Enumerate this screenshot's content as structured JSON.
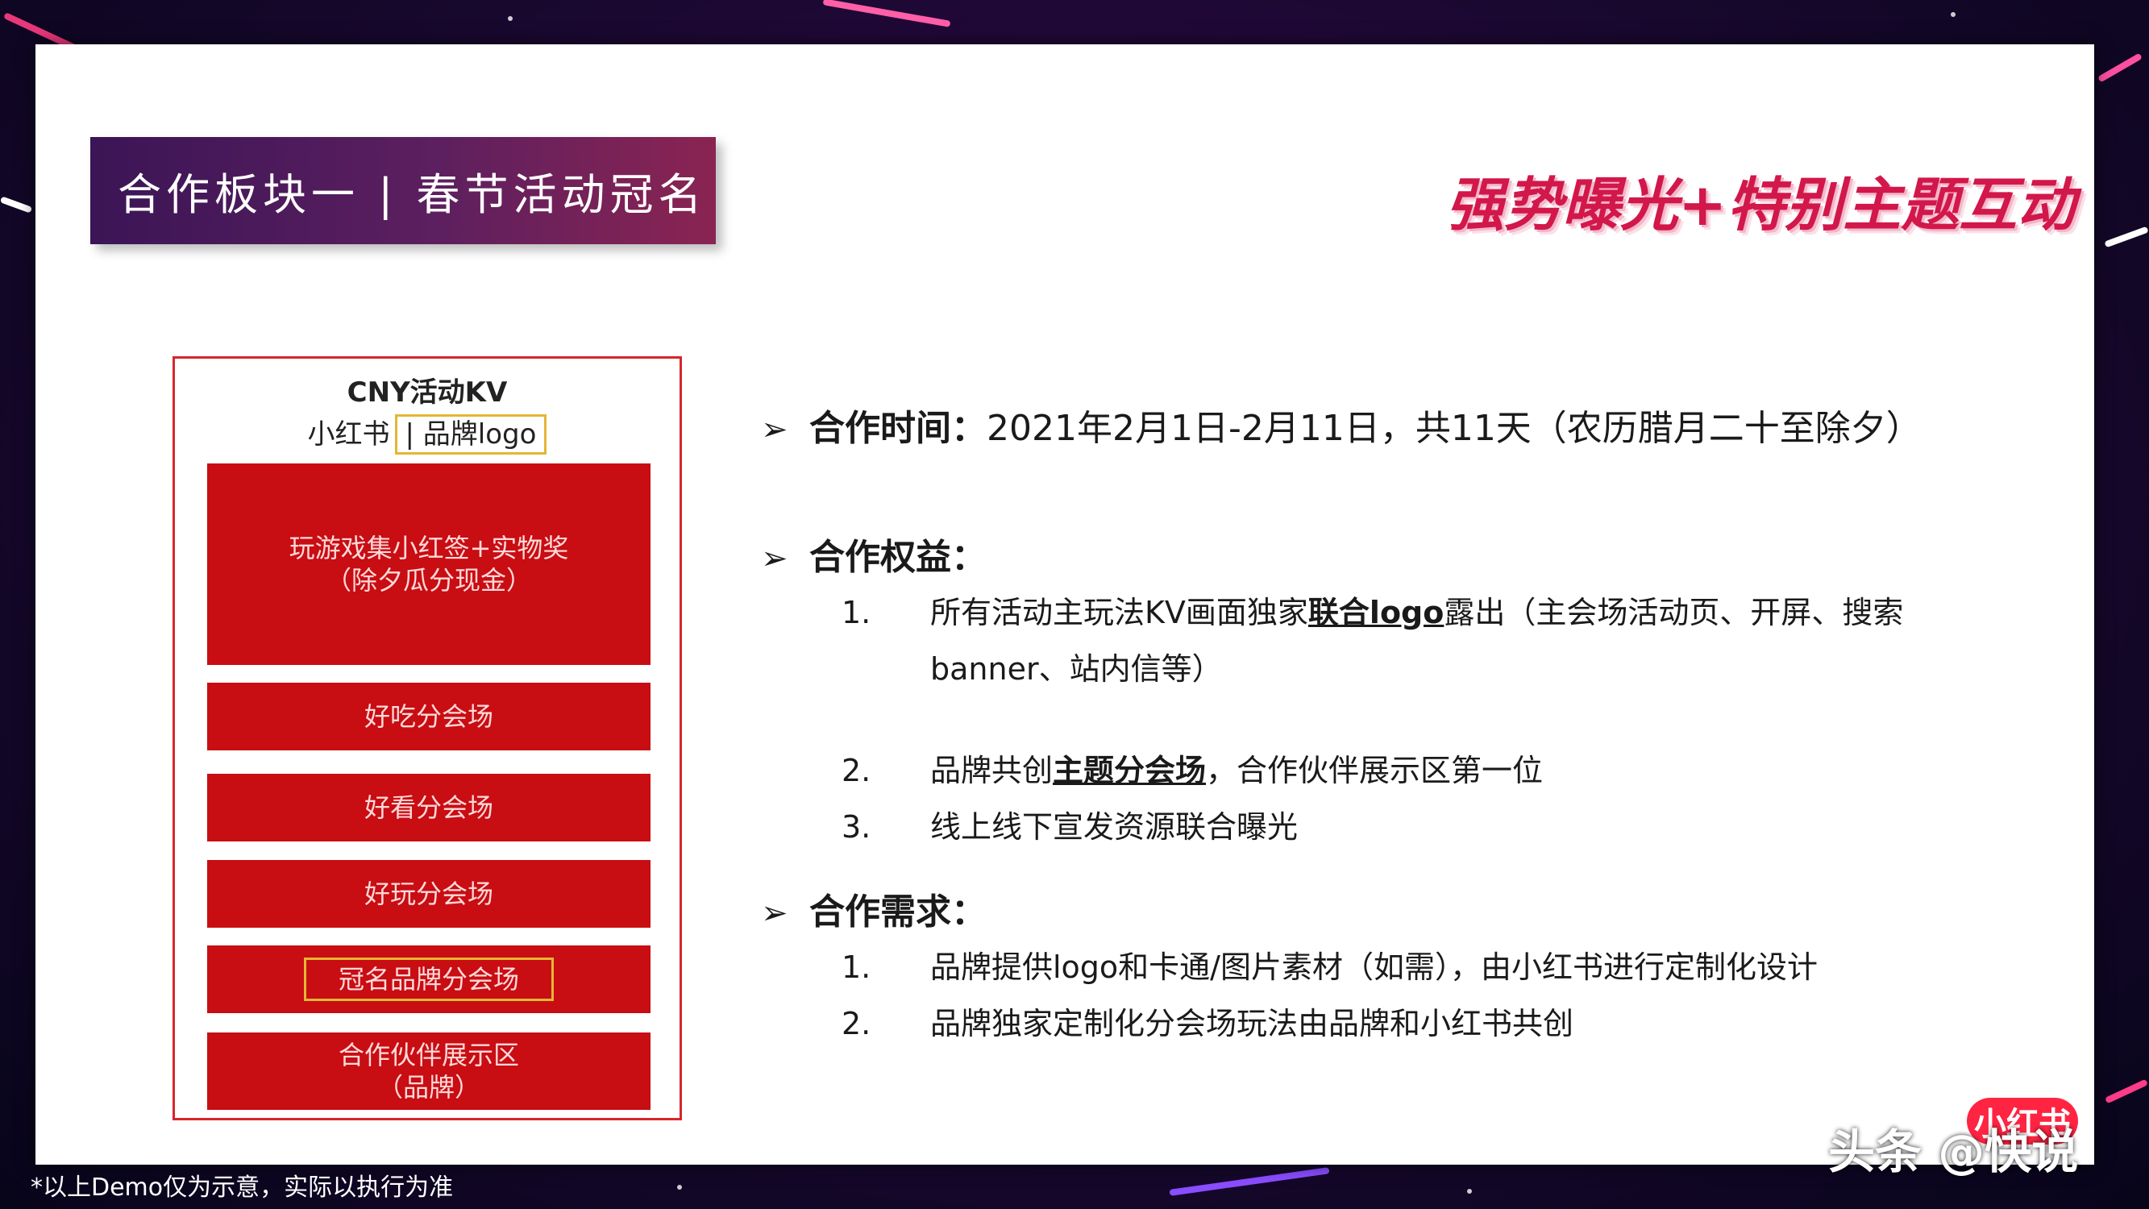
{
  "header": {
    "title": "合作板块一 | 春节活动冠名",
    "slogan": "强势曝光+特别主题互动"
  },
  "demo": {
    "kv_title": "CNY活动KV",
    "kv_brand_left": "小红书",
    "kv_brand_right": "| 品牌logo",
    "main_block_line1": "玩游戏集小红签+实物奖",
    "main_block_line2": "（除夕瓜分现金）",
    "venue_food": "好吃分会场",
    "venue_look": "好看分会场",
    "venue_play": "好玩分会场",
    "venue_brand": "冠名品牌分会场",
    "partner_line1": "合作伙伴展示区",
    "partner_line2": "（品牌）"
  },
  "content": {
    "arrow": "➢",
    "time_label": "合作时间：",
    "time_text": "2021年2月1日-2月11日，共11天（农历腊月二十至除夕）",
    "benefits_label": "合作权益：",
    "benefits": [
      {
        "num": "1.",
        "pre": "所有活动主玩法KV画面独家",
        "bold": "联合logo",
        "post": "露出（主会场活动页、开屏、搜索banner、站内信等）"
      },
      {
        "num": "2.",
        "pre": "品牌共创",
        "bold": "主题分会场",
        "post": "，合作伙伴展示区第一位"
      },
      {
        "num": "3.",
        "pre": "线上线下宣发资源联合曝光",
        "bold": "",
        "post": ""
      }
    ],
    "needs_label": "合作需求：",
    "needs": [
      {
        "num": "1.",
        "text": "品牌提供logo和卡通/图片素材（如需），由小红书进行定制化设计"
      },
      {
        "num": "2.",
        "text": "品牌独家定制化分会场玩法由品牌和小红书共创"
      }
    ]
  },
  "footer": {
    "note": "*以上Demo仅为示意，实际以执行为准",
    "watermark_text": "头条 @快说",
    "watermark_badge": "小红书"
  },
  "colors": {
    "brand_red": "#c80d13",
    "highlight_yellow": "#e3b733",
    "title_purple": "#3b1556",
    "slogan_pink": "#d2174a"
  }
}
